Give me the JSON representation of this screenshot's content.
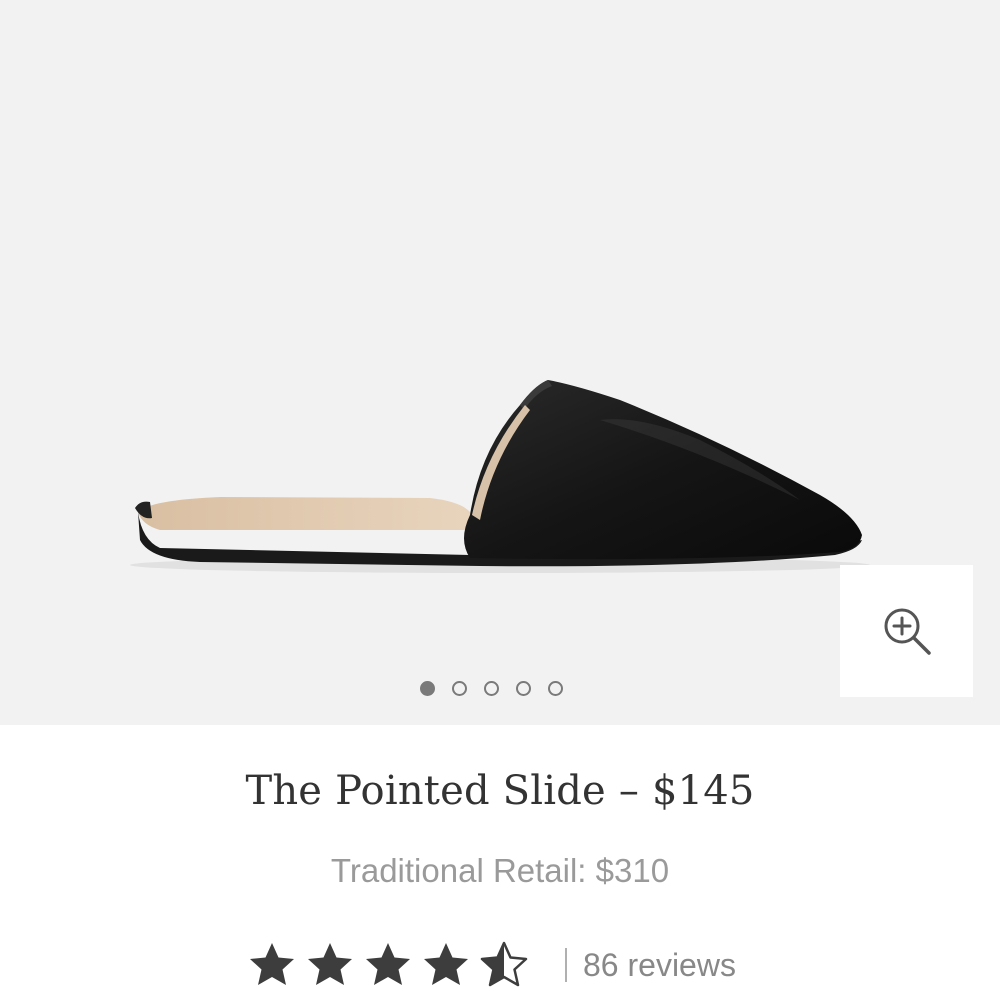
{
  "gallery": {
    "image": "black-pointed-leather-mule-photo",
    "background_color": "#f2f2f2",
    "slide_count": 5,
    "active_slide": 1,
    "zoom_icon": "zoom-in-icon"
  },
  "product": {
    "title": "The Pointed Slide – $145",
    "traditional_retail": "Traditional Retail: $310"
  },
  "rating": {
    "value": 4.5,
    "max": 5,
    "star_color": "#3d3d3d",
    "separator": "|",
    "reviews_text": "86 reviews"
  }
}
